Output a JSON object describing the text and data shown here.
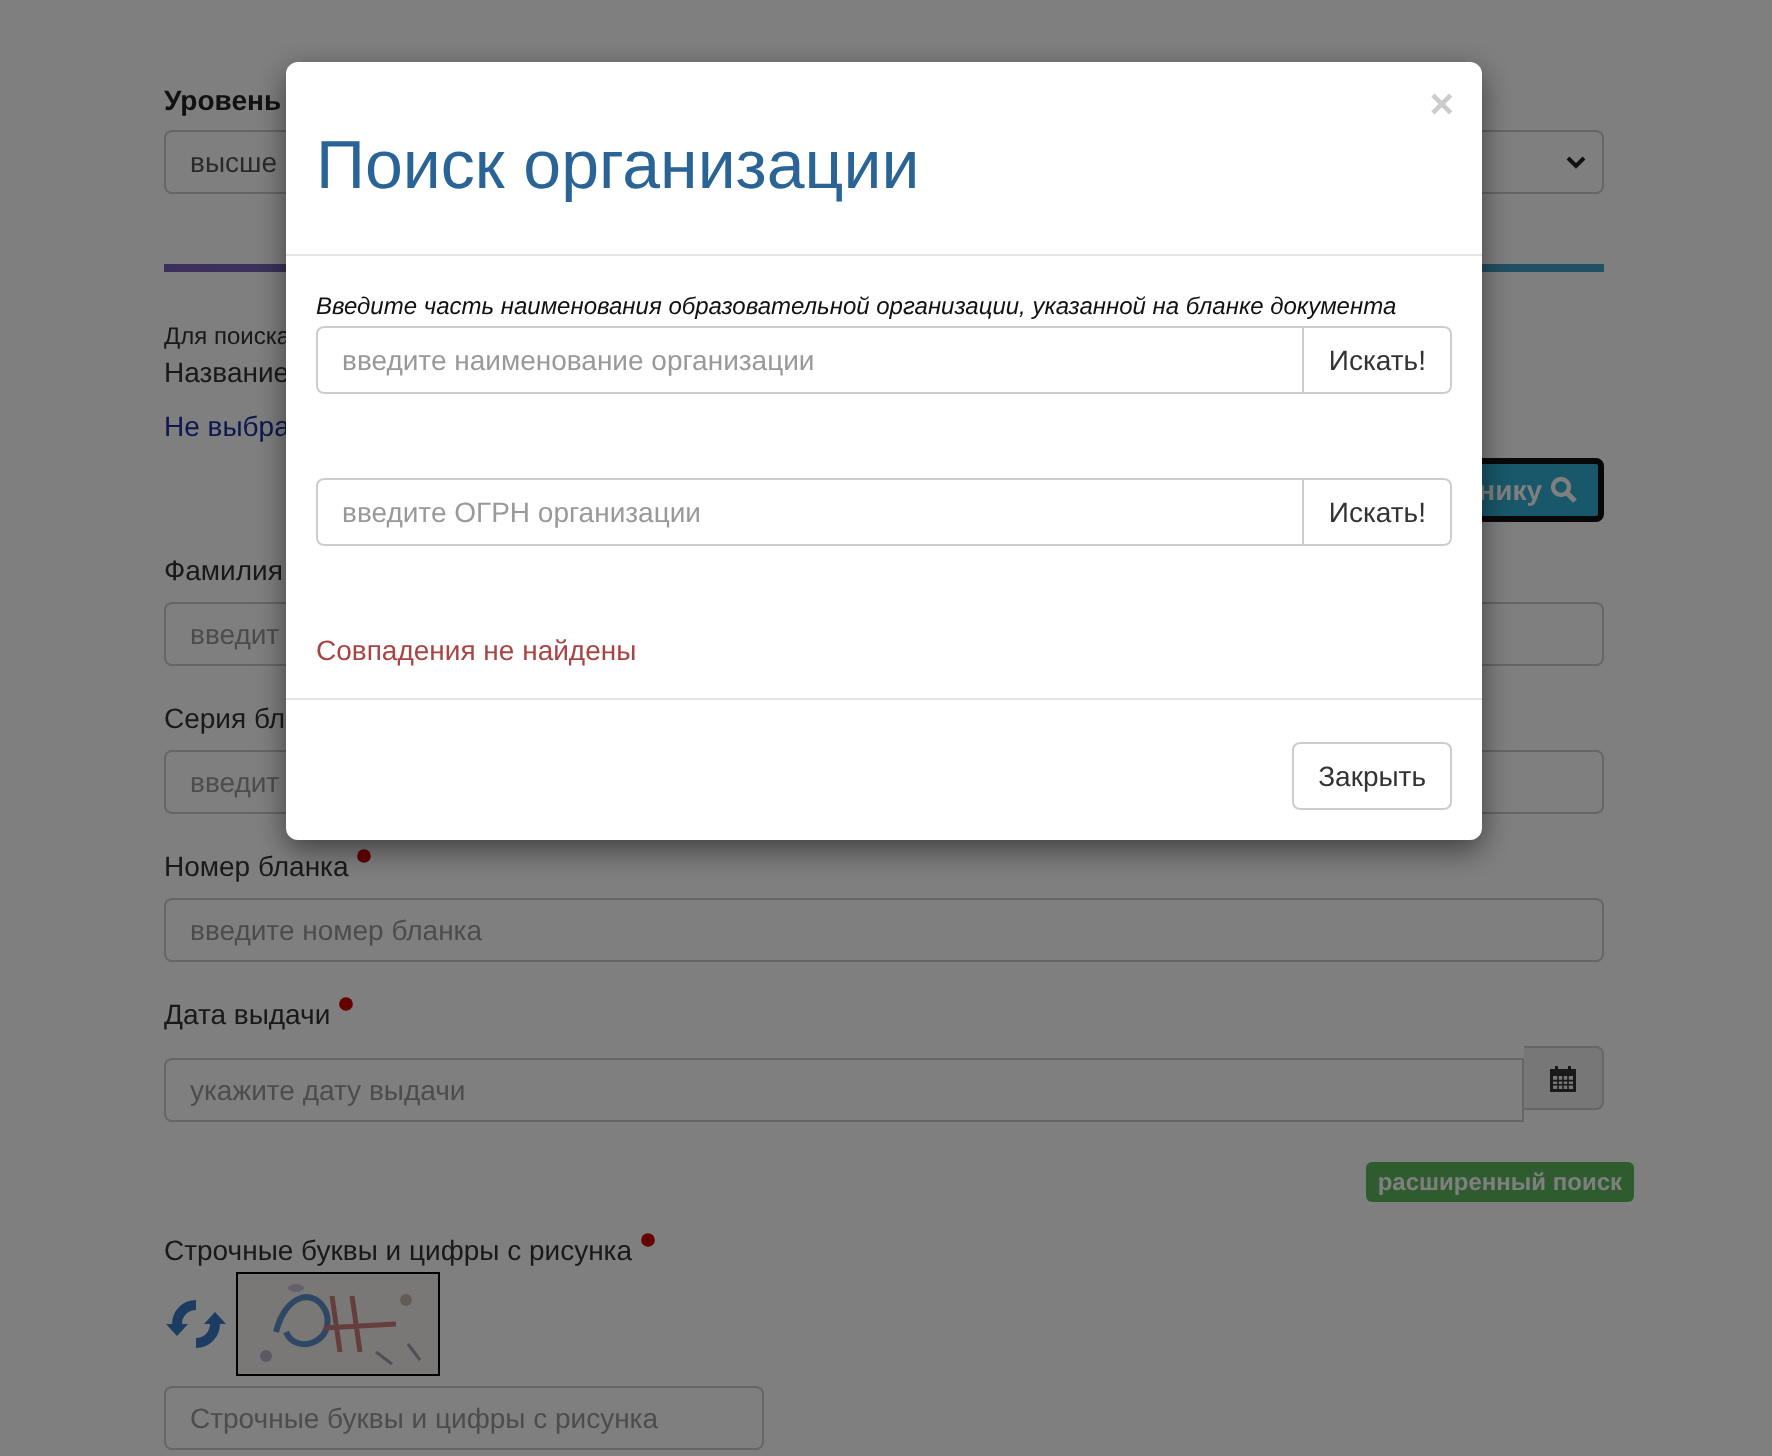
{
  "page": {
    "level_label": "Уровень",
    "level_select": {
      "value": "высше"
    },
    "progress": {
      "level": 1
    },
    "search_hint": "Для поиска",
    "name_label": "Название",
    "name_link": "Не выбра",
    "search_button": "нику",
    "fields": [
      {
        "kind": "text",
        "label": "Фамилия",
        "placeholder": "введит"
      },
      {
        "kind": "text",
        "label": "Серия бл",
        "placeholder": "введит"
      },
      {
        "kind": "text",
        "label": "Номер бланка",
        "required": true,
        "placeholder": "введите номер бланка"
      },
      {
        "kind": "date",
        "label": "Дата выдачи",
        "required": true,
        "placeholder": "укажите дату выдачи"
      }
    ],
    "advanced_search_badge": "расширенный поиск",
    "captcha": {
      "label": "Строчные буквы и цифры с рисунка",
      "required": true,
      "placeholder": "Строчные буквы и цифры с рисунка"
    }
  },
  "modal": {
    "title": "Поиск организации",
    "close_glyph": "×",
    "hint": "Введите часть наименования образовательной организации, указанной на бланке документа",
    "searches": [
      {
        "placeholder": "введите наименование организации",
        "button": "Искать!"
      },
      {
        "placeholder": "введите ОГРН организации",
        "button": "Искать!"
      }
    ],
    "message": "Совпадения не найдены",
    "close_button": "Закрыть"
  }
}
